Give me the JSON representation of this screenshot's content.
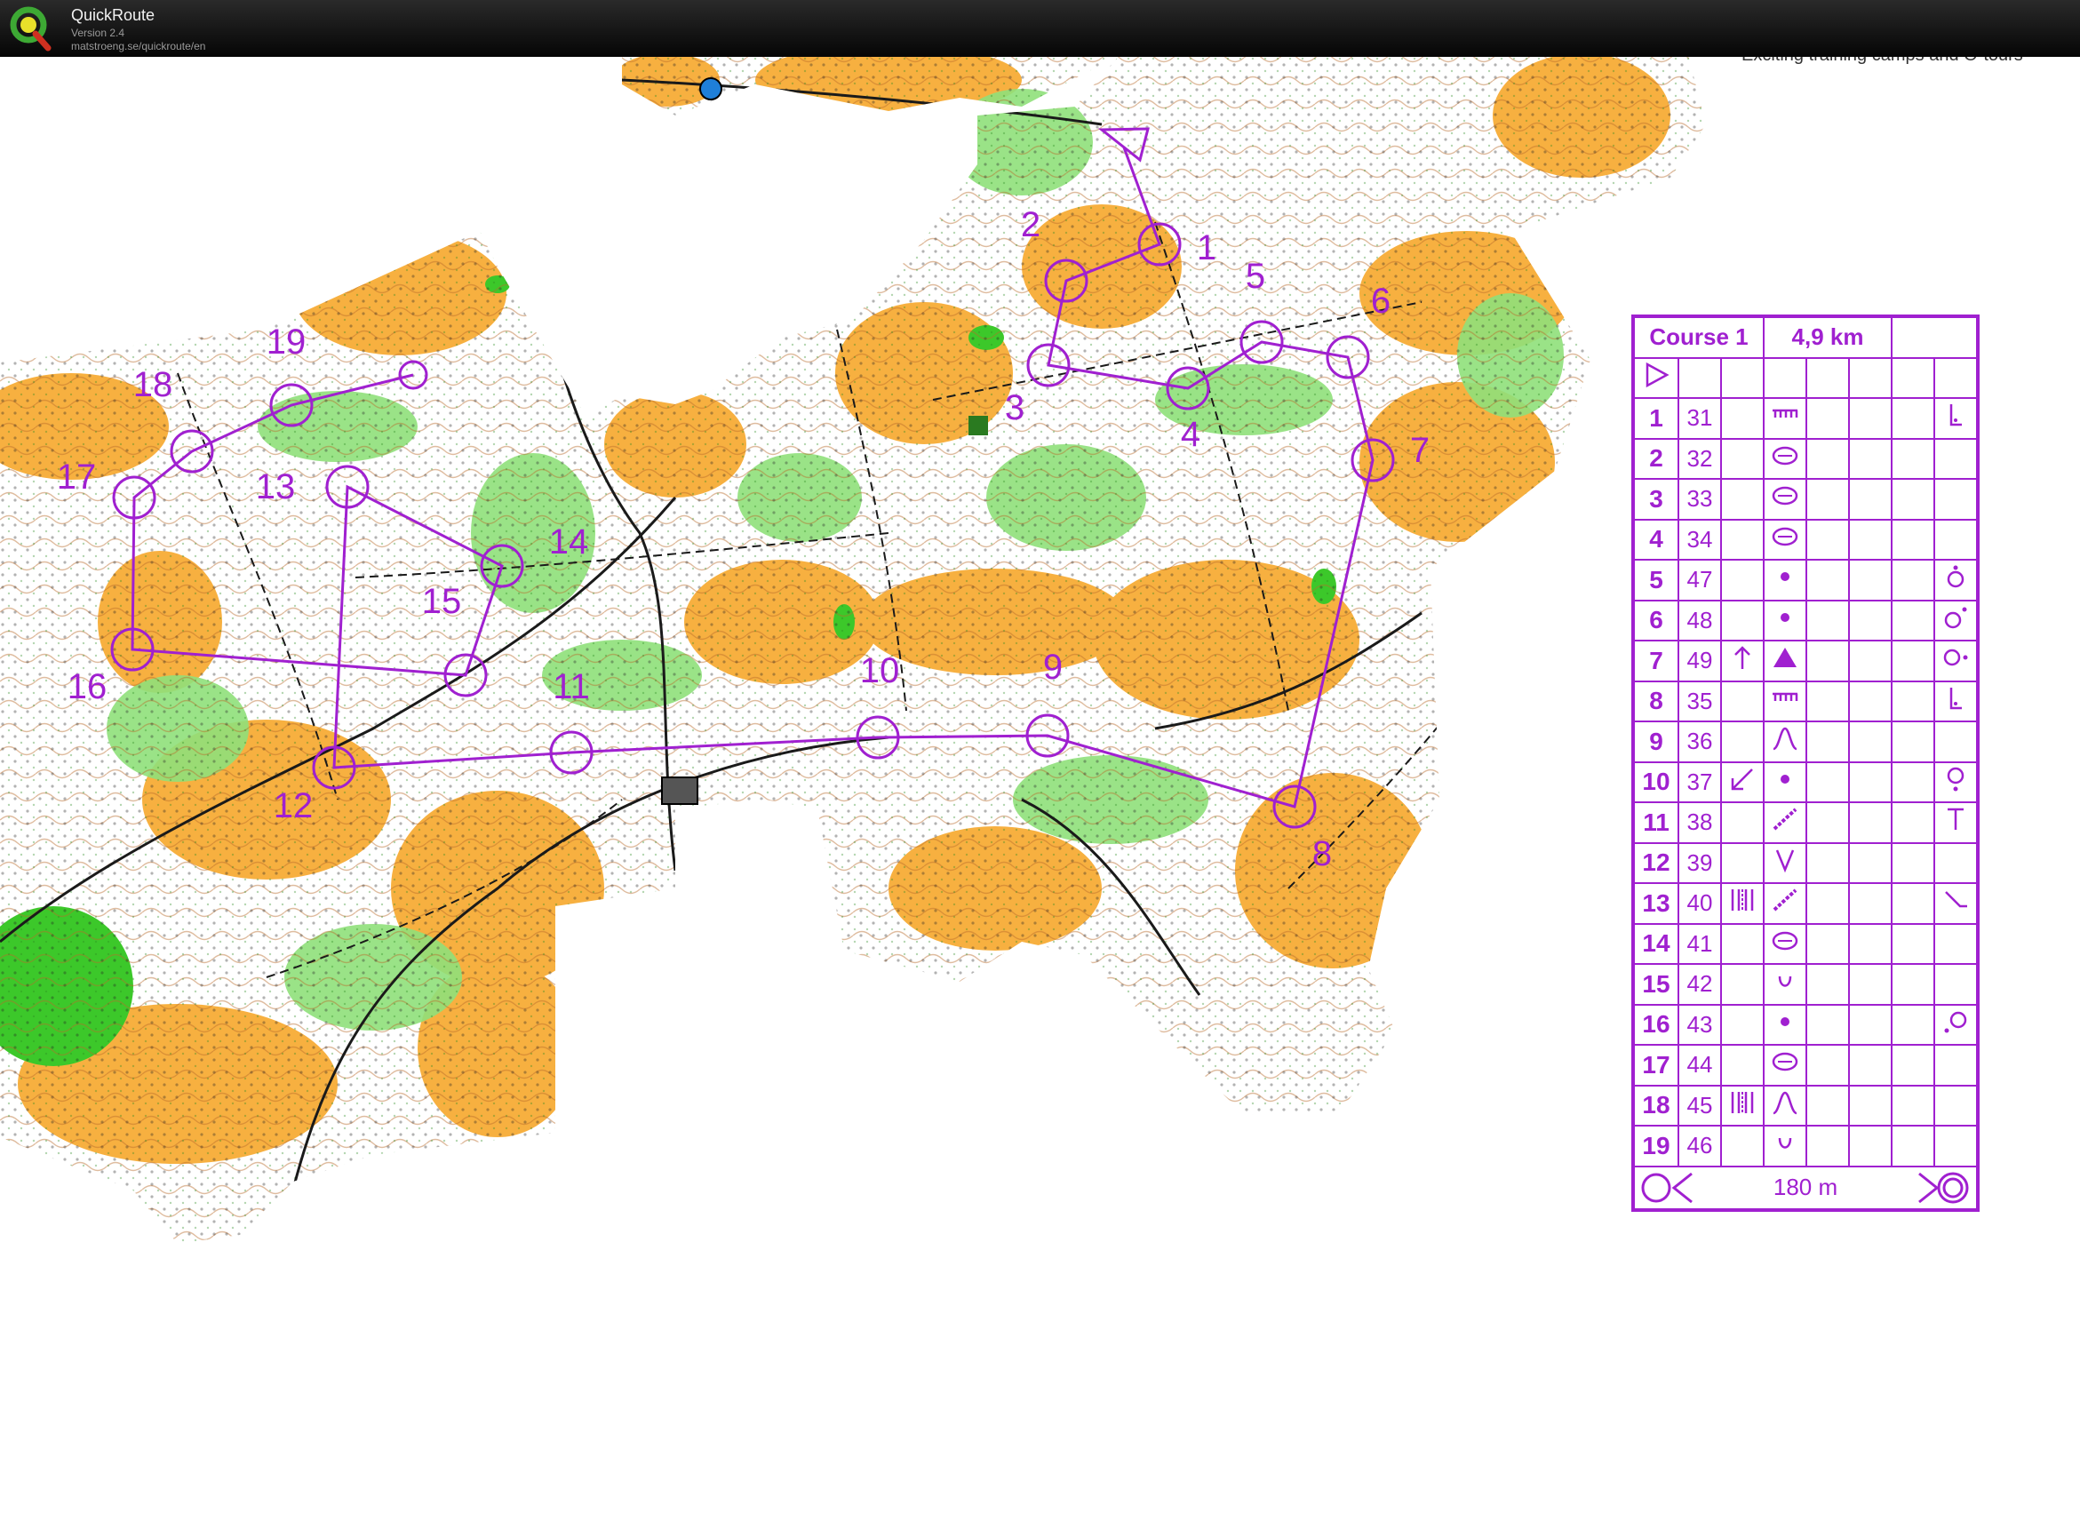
{
  "app": {
    "title": "QuickRoute",
    "version": "Version 2.4",
    "url": "matstroeng.se/quickroute/en"
  },
  "map": {
    "header_text": "Exciting training camps and O-tours",
    "course_color": "#a020d0",
    "controls": [
      {
        "label": "1"
      },
      {
        "label": "2"
      },
      {
        "label": "3"
      },
      {
        "label": "4"
      },
      {
        "label": "5"
      },
      {
        "label": "6"
      },
      {
        "label": "7"
      },
      {
        "label": "8"
      },
      {
        "label": "9"
      },
      {
        "label": "10"
      },
      {
        "label": "11"
      },
      {
        "label": "12"
      },
      {
        "label": "13"
      },
      {
        "label": "14"
      },
      {
        "label": "15"
      },
      {
        "label": "16"
      },
      {
        "label": "17"
      },
      {
        "label": "18"
      },
      {
        "label": "19"
      }
    ]
  },
  "description_sheet": {
    "course_name": "Course 1",
    "length": "4,9 km",
    "start_symbol": "start-triangle-icon",
    "rows": [
      {
        "num": "1",
        "code": "31",
        "c_dir": "",
        "d_feature": "fence-icon",
        "g": "",
        "h": "corner-icon"
      },
      {
        "num": "2",
        "code": "32",
        "c_dir": "",
        "d_feature": "depression-icon",
        "g": "",
        "h": ""
      },
      {
        "num": "3",
        "code": "33",
        "c_dir": "",
        "d_feature": "depression-icon",
        "g": "",
        "h": ""
      },
      {
        "num": "4",
        "code": "34",
        "c_dir": "",
        "d_feature": "depression-icon",
        "g": "",
        "h": ""
      },
      {
        "num": "5",
        "code": "47",
        "c_dir": "",
        "d_feature": "knoll-icon",
        "g": "",
        "h": "top-side-icon"
      },
      {
        "num": "6",
        "code": "48",
        "c_dir": "",
        "d_feature": "knoll-icon",
        "g": "",
        "h": "ne-side-icon"
      },
      {
        "num": "7",
        "code": "49",
        "c_dir": "up-arrow-icon",
        "d_feature": "boulder-icon",
        "g": "",
        "h": "east-side-icon"
      },
      {
        "num": "8",
        "code": "35",
        "c_dir": "",
        "d_feature": "fence-icon",
        "g": "",
        "h": "corner-icon"
      },
      {
        "num": "9",
        "code": "36",
        "c_dir": "",
        "d_feature": "spur-icon",
        "g": "",
        "h": ""
      },
      {
        "num": "10",
        "code": "37",
        "c_dir": "sw-arrow-icon",
        "d_feature": "knoll-icon",
        "g": "",
        "h": "south-side-icon"
      },
      {
        "num": "11",
        "code": "38",
        "c_dir": "",
        "d_feature": "path-icon",
        "g": "",
        "h": "t-junction-icon"
      },
      {
        "num": "12",
        "code": "39",
        "c_dir": "",
        "d_feature": "reentrant-icon",
        "g": "",
        "h": ""
      },
      {
        "num": "13",
        "code": "40",
        "c_dir": "rides-icon",
        "d_feature": "path-icon",
        "g": "",
        "h": "bend-icon"
      },
      {
        "num": "14",
        "code": "41",
        "c_dir": "",
        "d_feature": "depression-icon",
        "g": "",
        "h": ""
      },
      {
        "num": "15",
        "code": "42",
        "c_dir": "",
        "d_feature": "small-depression-icon",
        "g": "",
        "h": ""
      },
      {
        "num": "16",
        "code": "43",
        "c_dir": "",
        "d_feature": "knoll-icon",
        "g": "",
        "h": "nw-side-icon"
      },
      {
        "num": "17",
        "code": "44",
        "c_dir": "",
        "d_feature": "depression-icon",
        "g": "",
        "h": ""
      },
      {
        "num": "18",
        "code": "45",
        "c_dir": "rides-icon",
        "d_feature": "spur-icon",
        "g": "",
        "h": ""
      },
      {
        "num": "19",
        "code": "46",
        "c_dir": "",
        "d_feature": "small-depression-icon",
        "g": "",
        "h": ""
      }
    ],
    "finish_distance": "180 m"
  }
}
